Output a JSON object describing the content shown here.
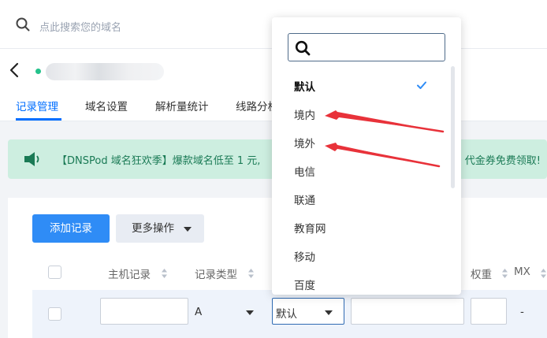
{
  "search": {
    "placeholder": "点此搜索您的域名"
  },
  "tabs": [
    {
      "label": "记录管理",
      "active": true
    },
    {
      "label": "域名设置"
    },
    {
      "label": "解析量统计"
    },
    {
      "label": "线路分析"
    }
  ],
  "banner": {
    "text": "【DNSPod 域名狂欢季】爆款域名低至 1 元,",
    "tail": "代金券免费领取!"
  },
  "toolbar": {
    "add_label": "添加记录",
    "more_label": "更多操作"
  },
  "table": {
    "headers": [
      "主机记录",
      "记录类型",
      "权重",
      "MX"
    ],
    "row": {
      "type": "A",
      "line": "默认",
      "mx": "-"
    }
  },
  "dropdown": {
    "options": [
      "默认",
      "境内",
      "境外",
      "电信",
      "联通",
      "教育网",
      "移动",
      "百度"
    ],
    "selected_index": 0
  },
  "colors": {
    "accent": "#006eff",
    "primary_button": "#2f8cf6",
    "banner_bg": "#cdeee0",
    "annotation_arrow": "#e8323a"
  }
}
